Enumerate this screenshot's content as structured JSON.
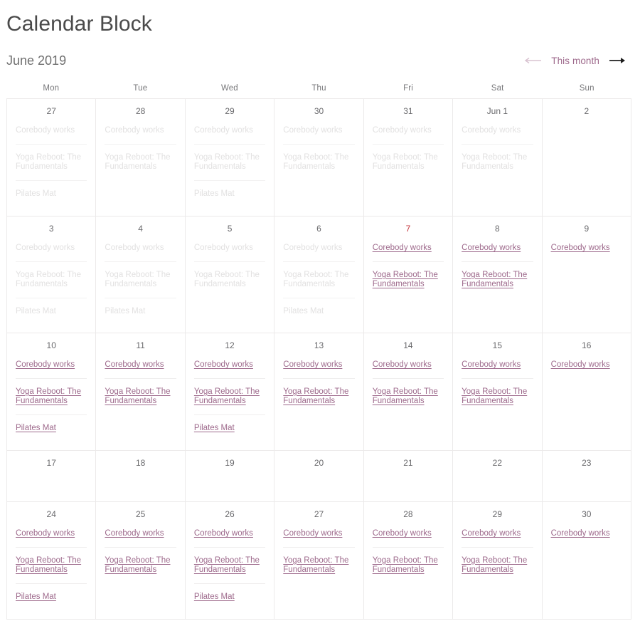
{
  "header": {
    "title": "Calendar Block",
    "month_label": "June 2019",
    "nav": {
      "prev_label": "←",
      "this_month_label": "This month",
      "next_label": "→"
    }
  },
  "colors": {
    "link": "#9e6a8c",
    "today": "#c4353c",
    "muted": "#e2e1e1",
    "grid_line": "#eceaea",
    "title": "#4a4a4a",
    "month": "#6f6f6f",
    "dow": "#77777a",
    "arrow_prev": "#d9c3d1",
    "arrow_next": "#1f1f1f"
  },
  "day_headers": [
    "Mon",
    "Tue",
    "Wed",
    "Thu",
    "Fri",
    "Sat",
    "Sun"
  ],
  "event_names": {
    "corebody": "Corebody works",
    "yoga": "Yoga Reboot: The Fundamentals",
    "pilates": "Pilates Mat"
  },
  "weeks": [
    [
      {
        "num": "27",
        "state": "past",
        "events": [
          "Corebody works",
          "Yoga Reboot: The Fundamentals",
          "Pilates Mat"
        ]
      },
      {
        "num": "28",
        "state": "past",
        "events": [
          "Corebody works",
          "Yoga Reboot: The Fundamentals"
        ]
      },
      {
        "num": "29",
        "state": "past",
        "events": [
          "Corebody works",
          "Yoga Reboot: The Fundamentals",
          "Pilates Mat"
        ]
      },
      {
        "num": "30",
        "state": "past",
        "events": [
          "Corebody works",
          "Yoga Reboot: The Fundamentals"
        ]
      },
      {
        "num": "31",
        "state": "past",
        "events": [
          "Corebody works",
          "Yoga Reboot: The Fundamentals"
        ]
      },
      {
        "num": "Jun 1",
        "state": "past",
        "events": [
          "Corebody works",
          "Yoga Reboot: The Fundamentals"
        ]
      },
      {
        "num": "2",
        "state": "past",
        "events": []
      }
    ],
    [
      {
        "num": "3",
        "state": "past",
        "events": [
          "Corebody works",
          "Yoga Reboot: The Fundamentals",
          "Pilates Mat"
        ]
      },
      {
        "num": "4",
        "state": "past",
        "events": [
          "Corebody works",
          "Yoga Reboot: The Fundamentals",
          "Pilates Mat"
        ]
      },
      {
        "num": "5",
        "state": "past",
        "events": [
          "Corebody works",
          "Yoga Reboot: The Fundamentals"
        ]
      },
      {
        "num": "6",
        "state": "past",
        "events": [
          "Corebody works",
          "Yoga Reboot: The Fundamentals",
          "Pilates Mat"
        ]
      },
      {
        "num": "7",
        "state": "today",
        "events": [
          "Corebody works",
          "Yoga Reboot: The Fundamentals"
        ]
      },
      {
        "num": "8",
        "state": "active",
        "events": [
          "Corebody works",
          "Yoga Reboot: The Fundamentals"
        ]
      },
      {
        "num": "9",
        "state": "active",
        "events": [
          "Corebody works"
        ]
      }
    ],
    [
      {
        "num": "10",
        "state": "active",
        "events": [
          "Corebody works",
          "Yoga Reboot: The Fundamentals",
          "Pilates Mat"
        ]
      },
      {
        "num": "11",
        "state": "active",
        "events": [
          "Corebody works",
          "Yoga Reboot: The Fundamentals"
        ]
      },
      {
        "num": "12",
        "state": "active",
        "events": [
          "Corebody works",
          "Yoga Reboot: The Fundamentals",
          "Pilates Mat"
        ]
      },
      {
        "num": "13",
        "state": "active",
        "events": [
          "Corebody works",
          "Yoga Reboot: The Fundamentals"
        ]
      },
      {
        "num": "14",
        "state": "active",
        "events": [
          "Corebody works",
          "Yoga Reboot: The Fundamentals"
        ]
      },
      {
        "num": "15",
        "state": "active",
        "events": [
          "Corebody works",
          "Yoga Reboot: The Fundamentals"
        ]
      },
      {
        "num": "16",
        "state": "active",
        "events": [
          "Corebody works"
        ]
      }
    ],
    [
      {
        "num": "17",
        "state": "active",
        "events": []
      },
      {
        "num": "18",
        "state": "active",
        "events": []
      },
      {
        "num": "19",
        "state": "active",
        "events": []
      },
      {
        "num": "20",
        "state": "active",
        "events": []
      },
      {
        "num": "21",
        "state": "active",
        "events": []
      },
      {
        "num": "22",
        "state": "active",
        "events": []
      },
      {
        "num": "23",
        "state": "active",
        "events": []
      }
    ],
    [
      {
        "num": "24",
        "state": "active",
        "events": [
          "Corebody works",
          "Yoga Reboot: The Fundamentals",
          "Pilates Mat"
        ]
      },
      {
        "num": "25",
        "state": "active",
        "events": [
          "Corebody works",
          "Yoga Reboot: The Fundamentals"
        ]
      },
      {
        "num": "26",
        "state": "active",
        "events": [
          "Corebody works",
          "Yoga Reboot: The Fundamentals",
          "Pilates Mat"
        ]
      },
      {
        "num": "27",
        "state": "active",
        "events": [
          "Corebody works",
          "Yoga Reboot: The Fundamentals"
        ]
      },
      {
        "num": "28",
        "state": "active",
        "events": [
          "Corebody works",
          "Yoga Reboot: The Fundamentals"
        ]
      },
      {
        "num": "29",
        "state": "active",
        "events": [
          "Corebody works",
          "Yoga Reboot: The Fundamentals"
        ]
      },
      {
        "num": "30",
        "state": "active",
        "events": [
          "Corebody works"
        ]
      }
    ]
  ]
}
